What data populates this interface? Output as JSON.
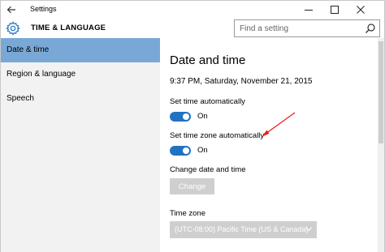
{
  "window": {
    "title": "Settings"
  },
  "header": {
    "section_title": "TIME & LANGUAGE",
    "search_placeholder": "Find a setting"
  },
  "sidebar": {
    "items": [
      {
        "label": "Date & time",
        "active": true
      },
      {
        "label": "Region & language",
        "active": false
      },
      {
        "label": "Speech",
        "active": false
      }
    ]
  },
  "main": {
    "title": "Date and time",
    "current_datetime": "9:37 PM, Saturday, November 21, 2015",
    "set_time_auto": {
      "label": "Set time automatically",
      "state": "On"
    },
    "set_timezone_auto": {
      "label": "Set time zone automatically",
      "state": "On"
    },
    "change_section": {
      "label": "Change date and time",
      "button": "Change"
    },
    "time_zone": {
      "label": "Time zone",
      "value": "(UTC-08:00) Pacific Time (US & Canada)"
    }
  },
  "colors": {
    "accent": "#1f72c4",
    "nav_active": "#7aa8d6",
    "sidebar_bg": "#f2f2f2",
    "disabled": "#cfcfcf",
    "annotation_arrow": "#e8201f"
  },
  "icons": {
    "back": "back-arrow-icon",
    "settings": "gear-icon",
    "search": "search-icon",
    "dropdown": "chevron-down-icon"
  }
}
